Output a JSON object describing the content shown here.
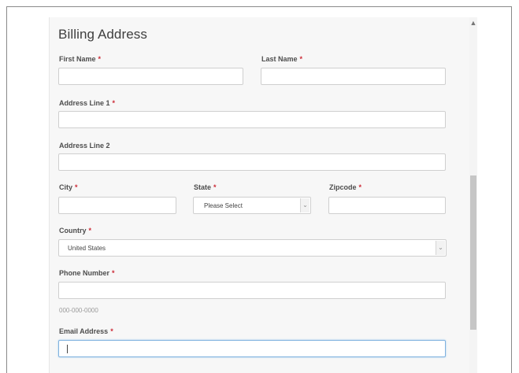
{
  "form": {
    "title": "Billing Address",
    "required_mark": "*",
    "fields": {
      "first_name": {
        "label": "First Name",
        "value": ""
      },
      "last_name": {
        "label": "Last Name",
        "value": ""
      },
      "address1": {
        "label": "Address Line 1",
        "value": ""
      },
      "address2": {
        "label": "Address Line 2",
        "value": ""
      },
      "city": {
        "label": "City",
        "value": ""
      },
      "state": {
        "label": "State",
        "selected": "Please Select"
      },
      "zipcode": {
        "label": "Zipcode",
        "value": ""
      },
      "country": {
        "label": "Country",
        "selected": "United States"
      },
      "phone": {
        "label": "Phone Number",
        "value": "",
        "hint": "000-000-0000"
      },
      "email": {
        "label": "Email Address",
        "value": ""
      }
    }
  },
  "icons": {
    "scroll_up": "▲",
    "select_arrow": "⌄"
  }
}
